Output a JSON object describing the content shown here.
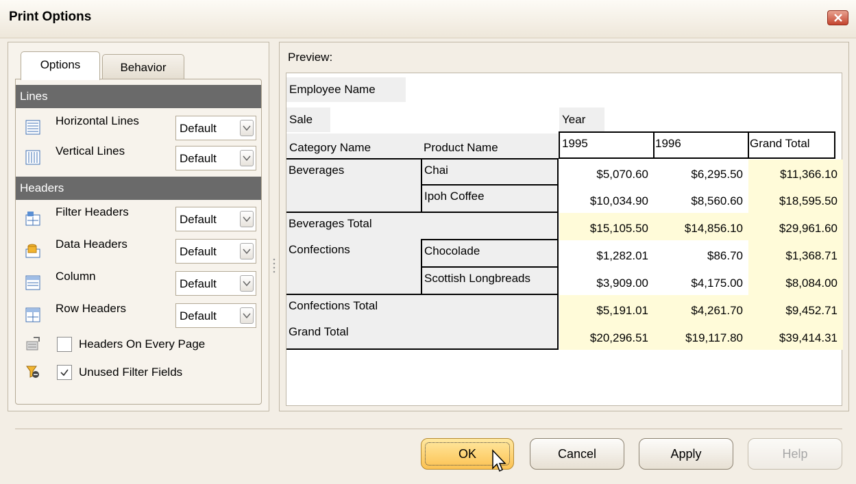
{
  "window": {
    "title": "Print Options"
  },
  "tabs": {
    "options": "Options",
    "behavior": "Behavior"
  },
  "sections": {
    "lines": "Lines",
    "headers": "Headers"
  },
  "options": {
    "horizontal_lines": {
      "label": "Horizontal Lines",
      "value": "Default"
    },
    "vertical_lines": {
      "label": "Vertical Lines",
      "value": "Default"
    },
    "filter_headers": {
      "label": "Filter Headers",
      "value": "Default"
    },
    "data_headers": {
      "label": "Data Headers",
      "value": "Default"
    },
    "column": {
      "label": "Column",
      "value": "Default"
    },
    "row_headers": {
      "label": "Row Headers",
      "value": "Default"
    }
  },
  "checks": {
    "headers_every_page": {
      "label": "Headers On Every Page",
      "checked": false
    },
    "unused_filter_fields": {
      "label": "Unused Filter Fields",
      "checked": true
    }
  },
  "preview": {
    "label": "Preview:",
    "filter_field": "Employee Name",
    "data_field": "Sale",
    "column_field": "Year",
    "row_headers": [
      "Category Name",
      "Product Name"
    ],
    "columns": [
      "1995",
      "1996",
      "Grand Total"
    ],
    "rows": [
      {
        "category": "Beverages",
        "product": "Chai",
        "values": [
          "$5,070.60",
          "$6,295.50",
          "$11,366.10"
        ]
      },
      {
        "product": "Ipoh Coffee",
        "values": [
          "$10,034.90",
          "$8,560.60",
          "$18,595.50"
        ]
      },
      {
        "total": "Beverages Total",
        "values": [
          "$15,105.50",
          "$14,856.10",
          "$29,961.60"
        ]
      },
      {
        "category": "Confections",
        "product": "Chocolade",
        "values": [
          "$1,282.01",
          "$86.70",
          "$1,368.71"
        ]
      },
      {
        "product": "Scottish Longbreads",
        "values": [
          "$3,909.00",
          "$4,175.00",
          "$8,084.00"
        ]
      },
      {
        "total": "Confections Total",
        "values": [
          "$5,191.01",
          "$4,261.70",
          "$9,452.71"
        ]
      },
      {
        "total": "Grand Total",
        "values": [
          "$20,296.51",
          "$19,117.80",
          "$39,414.31"
        ]
      }
    ]
  },
  "buttons": {
    "ok": "OK",
    "cancel": "Cancel",
    "apply": "Apply",
    "help": "Help"
  },
  "colors": {
    "accent_ok": "#fcc252",
    "section_header": "#6a6a6a",
    "total_cell": "#fffbd9",
    "header_cell": "#efefef"
  }
}
